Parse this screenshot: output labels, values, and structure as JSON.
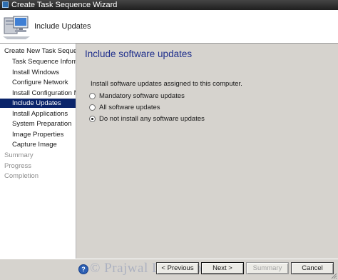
{
  "window": {
    "title": "Create Task Sequence Wizard"
  },
  "header": {
    "title": "Include Updates",
    "icon": "computer-wizard-icon"
  },
  "sidebar": {
    "items": [
      {
        "label": "Create New Task Sequence",
        "level": "top",
        "state": "normal"
      },
      {
        "label": "Task Sequence Information",
        "level": "sub",
        "state": "normal"
      },
      {
        "label": "Install Windows",
        "level": "sub",
        "state": "normal"
      },
      {
        "label": "Configure Network",
        "level": "sub",
        "state": "normal"
      },
      {
        "label": "Install Configuration Manag",
        "level": "sub",
        "state": "normal"
      },
      {
        "label": "Include Updates",
        "level": "sub",
        "state": "selected"
      },
      {
        "label": "Install Applications",
        "level": "sub",
        "state": "normal"
      },
      {
        "label": "System Preparation",
        "level": "sub",
        "state": "normal"
      },
      {
        "label": "Image Properties",
        "level": "sub",
        "state": "normal"
      },
      {
        "label": "Capture Image",
        "level": "sub",
        "state": "normal"
      },
      {
        "label": "Summary",
        "level": "top",
        "state": "disabled"
      },
      {
        "label": "Progress",
        "level": "top",
        "state": "disabled"
      },
      {
        "label": "Completion",
        "level": "top",
        "state": "disabled"
      }
    ]
  },
  "main": {
    "title": "Include software updates",
    "instruction": "Install software updates assigned to this computer.",
    "options": [
      {
        "label": "Mandatory software updates",
        "checked": false
      },
      {
        "label": "All software updates",
        "checked": false
      },
      {
        "label": "Do not install any software updates",
        "checked": true
      }
    ]
  },
  "footer": {
    "watermark": "© Prajwal Desai.com",
    "buttons": {
      "previous": "< Previous",
      "next": "Next >",
      "summary": "Summary",
      "cancel": "Cancel"
    }
  },
  "colors": {
    "title_blue": "#1f2f8c",
    "selection": "#0a246a",
    "panel": "#d6d3ce",
    "titlebar": "#2b2b2b"
  }
}
